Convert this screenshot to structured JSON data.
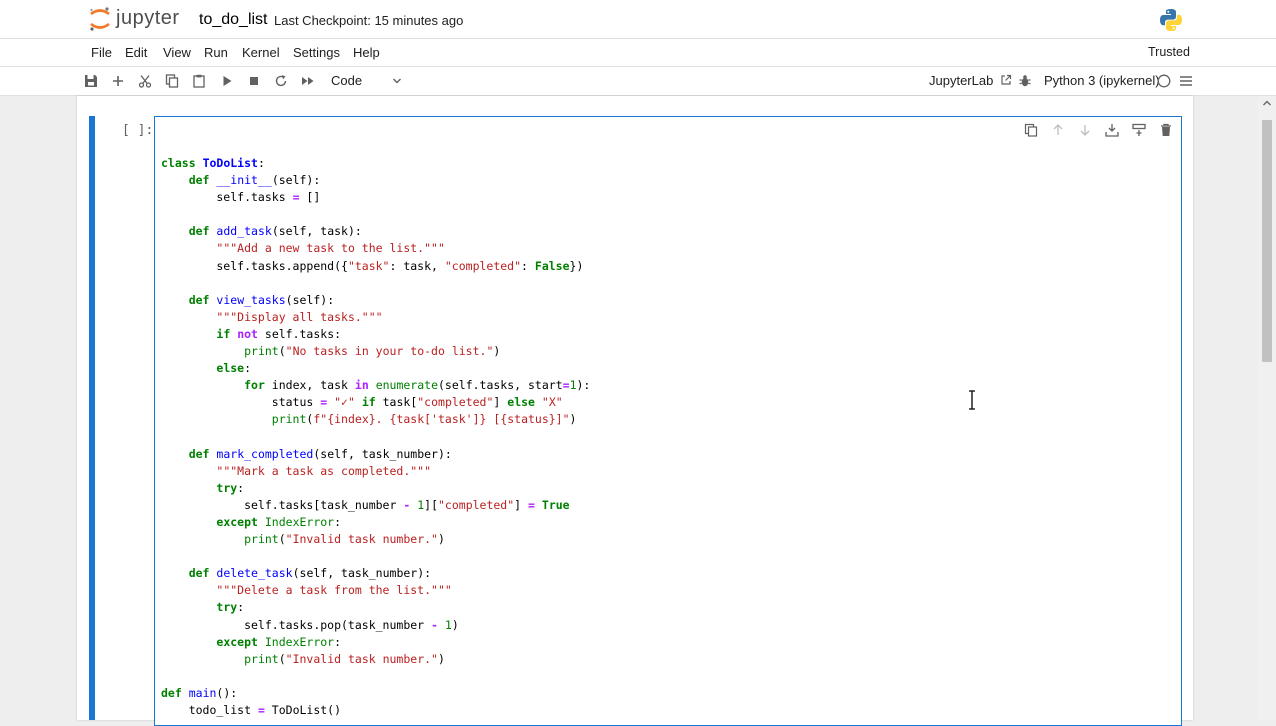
{
  "header": {
    "brand": "jupyter",
    "notebook_title": "to_do_list",
    "checkpoint": "Last Checkpoint: 15 minutes ago"
  },
  "menu": {
    "items": [
      "File",
      "Edit",
      "View",
      "Run",
      "Kernel",
      "Settings",
      "Help"
    ],
    "trusted": "Trusted"
  },
  "toolbar": {
    "cell_type": "Code",
    "jupyterlab_label": "JupyterLab",
    "kernel": "Python 3 (ipykernel)"
  },
  "cell": {
    "prompt": "[ ]:",
    "lines": [
      "class ToDoList:",
      "    def __init__(self):",
      "        self.tasks = []",
      "",
      "    def add_task(self, task):",
      "        \"\"\"Add a new task to the list.\"\"\"",
      "        self.tasks.append({\"task\": task, \"completed\": False})",
      "",
      "    def view_tasks(self):",
      "        \"\"\"Display all tasks.\"\"\"",
      "        if not self.tasks:",
      "            print(\"No tasks in your to-do list.\")",
      "        else:",
      "            for index, task in enumerate(self.tasks, start=1):",
      "                status = \"✓\" if task[\"completed\"] else \"X\"",
      "                print(f\"{index}. {task['task']} [{status}]\")",
      "",
      "    def mark_completed(self, task_number):",
      "        \"\"\"Mark a task as completed.\"\"\"",
      "        try:",
      "            self.tasks[task_number - 1][\"completed\"] = True",
      "        except IndexError:",
      "            print(\"Invalid task number.\")",
      "",
      "    def delete_task(self, task_number):",
      "        \"\"\"Delete a task from the list.\"\"\"",
      "        try:",
      "            self.tasks.pop(task_number - 1)",
      "        except IndexError:",
      "            print(\"Invalid task number.\")",
      "",
      "def main():",
      "    todo_list = ToDoList()"
    ]
  },
  "colors": {
    "accent": "#1976d2",
    "keyword": "#008000",
    "string": "#ba2121",
    "def_name": "#0000ff",
    "operator": "#aa22ff"
  },
  "icons": {
    "toolbar": [
      "save-icon",
      "add-cell-icon",
      "cut-icon",
      "copy-icon",
      "paste-icon",
      "run-icon",
      "stop-icon",
      "restart-icon",
      "fast-forward-icon"
    ],
    "cell_tools": [
      "duplicate-icon",
      "move-up-icon",
      "move-down-icon",
      "insert-below-icon",
      "insert-above-icon",
      "delete-icon"
    ]
  }
}
